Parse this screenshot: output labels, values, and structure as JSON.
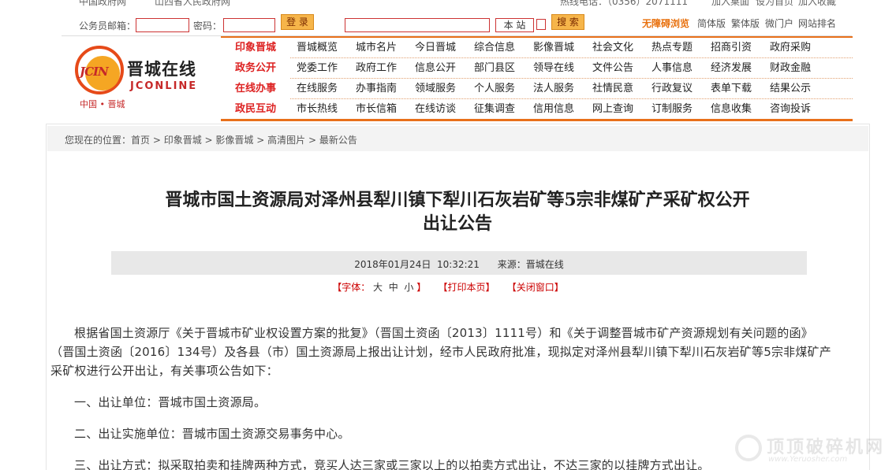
{
  "top_links": [
    "中国政府网",
    "山西省人民政府网"
  ],
  "hotline": "热线电话：（0356）2071111",
  "top_right": [
    "加入桌面",
    "设为首页",
    "加入收藏"
  ],
  "login": {
    "email_label": "公务员邮箱：",
    "password_label": "密码：",
    "login_button": "登 录",
    "site_button": "本 站",
    "search_button": "搜 索"
  },
  "accessible": "无障碍浏览",
  "site_links": [
    "简体版",
    "繁体版",
    "微门户",
    "网站排名"
  ],
  "logo": {
    "mark": "JCIN",
    "name": "晋城在线",
    "english": "JCONLINE",
    "tagline": "中国 • 晋城"
  },
  "nav": [
    {
      "cat": "印象晋城",
      "items": [
        "晋城概览",
        "城市名片",
        "今日晋城",
        "综合信息",
        "影像晋城",
        "社会文化",
        "热点专题",
        "招商引资",
        "政府采购"
      ]
    },
    {
      "cat": "政务公开",
      "items": [
        "党委工作",
        "政府工作",
        "信息公开",
        "部门县区",
        "领导在线",
        "文件公告",
        "人事信息",
        "经济发展",
        "财政金融"
      ]
    },
    {
      "cat": "在线办事",
      "items": [
        "在线服务",
        "办事指南",
        "领域服务",
        "个人服务",
        "法人服务",
        "社情民意",
        "行政复议",
        "表单下载",
        "结果公示"
      ]
    },
    {
      "cat": "政民互动",
      "items": [
        "市长热线",
        "市长信箱",
        "在线访谈",
        "征集调查",
        "信用信息",
        "网上查询",
        "订制服务",
        "信息收集",
        "咨询投诉"
      ]
    }
  ],
  "breadcrumb": {
    "prefix": "您现在的位置：",
    "items": [
      "首页",
      "印象晋城",
      "影像晋城",
      "高清图片",
      "最新公告"
    ],
    "separator": " > "
  },
  "article": {
    "title_line1": "晋城市国土资源局对泽州县犁川镇下犁川石灰岩矿等5宗非煤矿产采矿权公开",
    "title_line2": "出让公告",
    "meta": "2018年01月24日  10:32:21      来源：晋城在线",
    "font_label": "【字体：",
    "font_big": "大",
    "font_mid": "中",
    "font_small": "小",
    "font_end": "】",
    "print": "【打印本页】",
    "close": "【关闭窗口】",
    "p1_line1": "根据省国土资源厅《关于晋城市矿业权设置方案的批复》（晋国土资函〔2013〕1111号）和《关于调整晋城市矿产资源规划有关问题的函》",
    "p1_line2": "（晋国土资函〔2016〕134号）及各县（市）国土资源局上报出让计划，经市人民政府批准，现拟定对泽州县犁川镇下犁川石灰岩矿等5宗非煤矿产",
    "p1_line3": "采矿权进行公开出让，有关事项公告如下：",
    "p2": "一、出让单位：晋城市国土资源局。",
    "p3": "二、出让实施单位：晋城市国土资源交易事务中心。",
    "p4": "三、出让方式：拟采取拍卖和挂牌两种方式，竞买人达三家或三家以上的以拍卖方式出让，不达三家的以挂牌方式出让。"
  },
  "watermark": {
    "text": "顶顶破碎机网",
    "url": "www.Yeruosher.com"
  }
}
